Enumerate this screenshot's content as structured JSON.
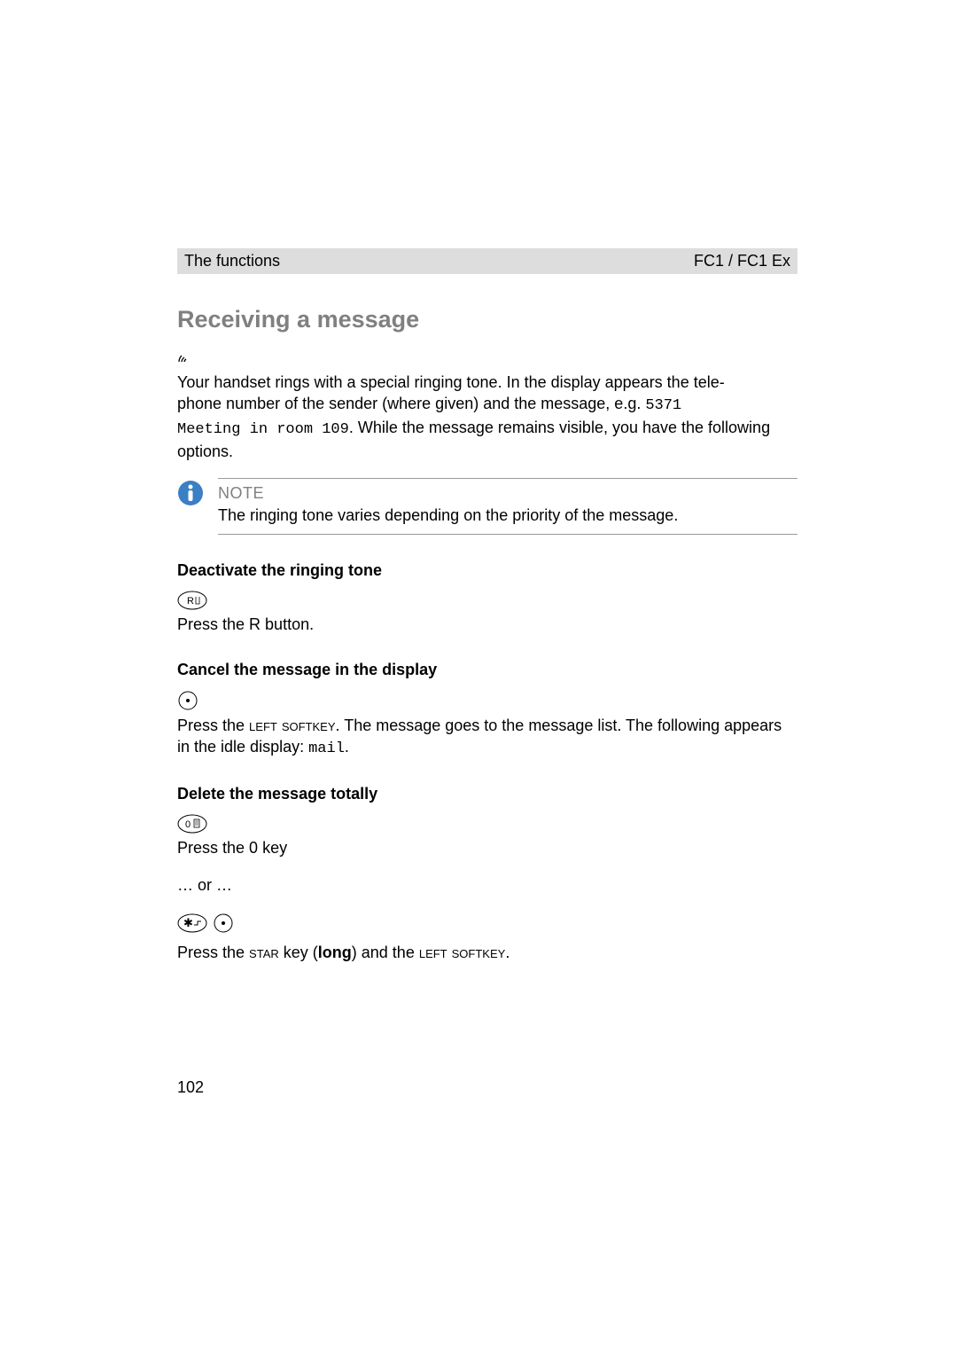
{
  "header": {
    "left": "The functions",
    "right": "FC1 / FC1 Ex"
  },
  "title": "Receiving a message",
  "intro": {
    "line1": "Your handset rings with a special ringing tone. In the display appears the tele-",
    "line2_prefix": "phone number of the sender (where given) and the message, e.g. ",
    "example1": "5371",
    "example2": "Meeting in room 109",
    "line2_suffix": ". While the message remains visible, you have the following options."
  },
  "note": {
    "heading": "NOTE",
    "text": "The ringing tone varies depending on the priority of the message."
  },
  "sections": {
    "deactivate": {
      "heading": "Deactivate the ringing tone",
      "text_prefix": "Press the ",
      "key": "R",
      "text_suffix": " button."
    },
    "cancel": {
      "heading": "Cancel the message in the display",
      "text_prefix": "Press the ",
      "softkey": "left softkey",
      "text_mid": ". The message goes to the message list. The following appears in the idle display: ",
      "mono": "mail",
      "text_suffix": "."
    },
    "delete": {
      "heading": "Delete the message totally",
      "step1_prefix": "Press the ",
      "step1_key": "0",
      "step1_suffix": " key",
      "or": "… or …",
      "step2_prefix": "Press the ",
      "step2_key": "star",
      "step2_mid": " key (",
      "step2_bold": "long",
      "step2_mid2": ") and the ",
      "step2_softkey": "left softkey",
      "step2_suffix": "."
    }
  },
  "page_number": "102"
}
